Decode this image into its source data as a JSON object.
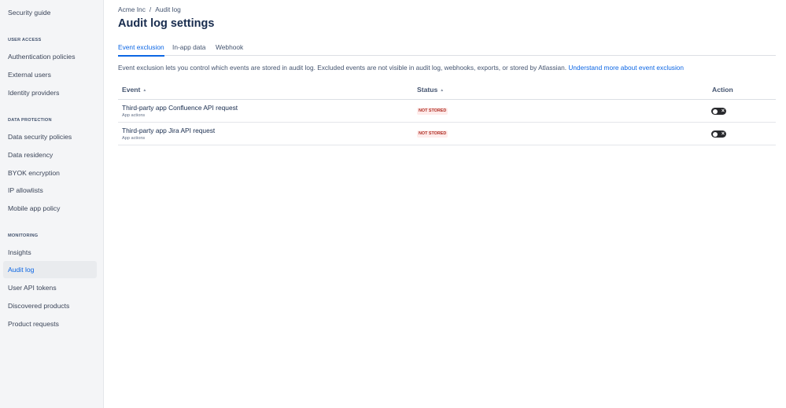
{
  "sidebar": {
    "top_item": "Security guide",
    "sections": [
      {
        "title": "USER ACCESS",
        "items": [
          "Authentication policies",
          "External users",
          "Identity providers"
        ]
      },
      {
        "title": "DATA PROTECTION",
        "items": [
          "Data security policies",
          "Data residency",
          "BYOK encryption",
          "IP allowlists",
          "Mobile app policy"
        ]
      },
      {
        "title": "MONITORING",
        "items": [
          "Insights",
          "Audit log",
          "User API tokens",
          "Discovered products",
          "Product requests"
        ]
      }
    ],
    "active_item": "Audit log"
  },
  "breadcrumb": {
    "org": "Acme Inc",
    "separator": "/",
    "current": "Audit log"
  },
  "page_title": "Audit log settings",
  "tabs": [
    {
      "label": "Event exclusion",
      "active": true
    },
    {
      "label": "In-app data",
      "active": false
    },
    {
      "label": "Webhook",
      "active": false
    }
  ],
  "description": {
    "text": "Event exclusion lets you control which events are stored in audit log. Excluded events are not visible in audit log, webhooks, exports, or stored by Atlassian.",
    "link": "Understand more about event exclusion"
  },
  "table": {
    "columns": [
      {
        "label": "Event",
        "sortable": true
      },
      {
        "label": "Status",
        "sortable": true
      },
      {
        "label": "Action",
        "sortable": false
      }
    ],
    "rows": [
      {
        "event": "Third-party app Confluence API request",
        "category": "App actions",
        "status": "NOT STORED",
        "toggle_on": false
      },
      {
        "event": "Third-party app Jira API request",
        "category": "App actions",
        "status": "NOT STORED",
        "toggle_on": false
      }
    ]
  },
  "icons": {
    "sort": "sort-arrows-icon",
    "toggle_off": "close-icon"
  },
  "colors": {
    "accent": "#0c66e4",
    "badge_bg": "#ffeceb",
    "badge_text": "#ae2e24",
    "sidebar_bg": "#f4f5f7",
    "toggle_bg": "#292a2e"
  }
}
